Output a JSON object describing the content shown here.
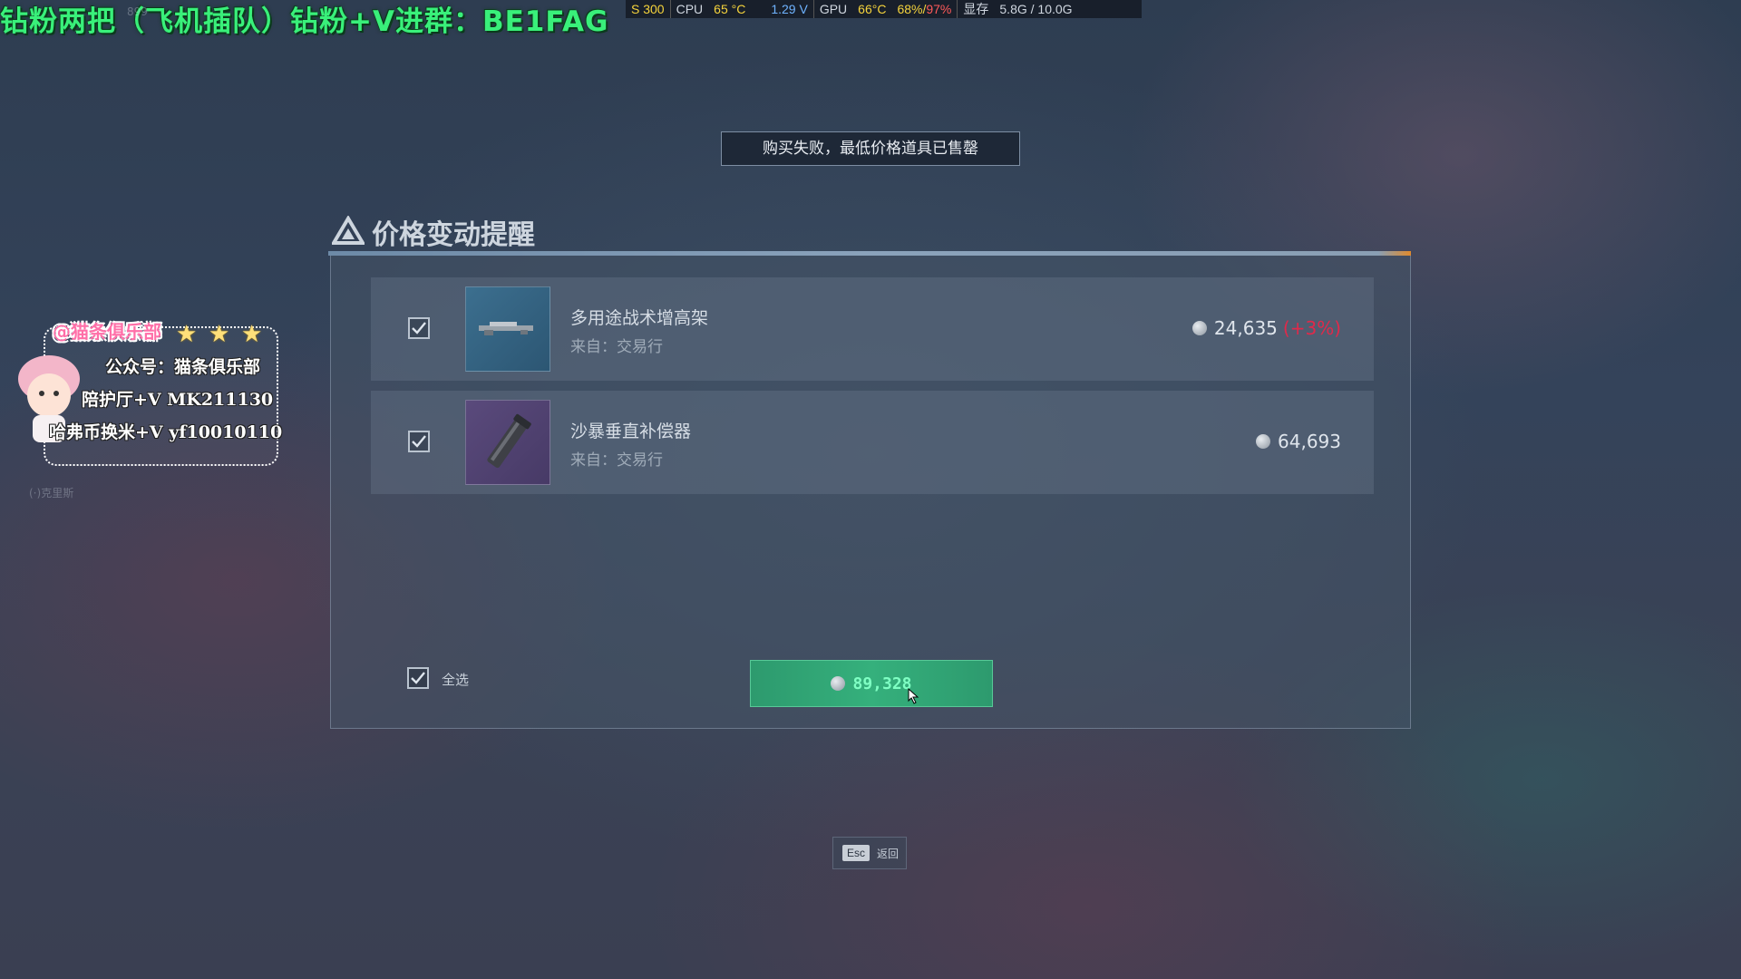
{
  "overlay": {
    "banner": "钻粉两把（飞机插队）钻粉+V进群：BE1FAG",
    "faint_number": "899",
    "faint_side_text": "克里斯"
  },
  "hw_monitor": {
    "fps_label": "S",
    "fps_value": "300",
    "cpu_label": "CPU",
    "cpu_temp": "65 °C",
    "voltage": "1.29 V",
    "gpu_label": "GPU",
    "gpu_temp": "66°C",
    "gpu_usage": "68%",
    "gpu_usage2": "97%",
    "vram_label": "显存",
    "vram_value": "5.8G / 10.0G"
  },
  "toast": {
    "message": "购买失败，最低价格道具已售罄"
  },
  "panel": {
    "title": "价格变动提醒",
    "items": [
      {
        "name": "多用途战术增高架",
        "source": "来自：交易行",
        "price": "24,635",
        "change": "(+3%)",
        "checked": true,
        "thumb_icon": "rifle-riser-icon"
      },
      {
        "name": "沙暴垂直补偿器",
        "source": "来自：交易行",
        "price": "64,693",
        "change": "",
        "checked": true,
        "thumb_icon": "compensator-icon"
      }
    ],
    "select_all_label": "全选",
    "total": "89,328"
  },
  "esc_hint": {
    "key": "Esc",
    "label": "返回"
  },
  "sticker": {
    "title": "@猫条俱乐部",
    "line1": "公众号：猫条俱乐部",
    "line2": "陪护厅+V  MK211130",
    "line3": "哈弗币换米+V  yf10010110"
  },
  "colors": {
    "accent_green": "#35b07c",
    "price_up_red": "#e0294a",
    "banner_green": "#39f07a"
  }
}
